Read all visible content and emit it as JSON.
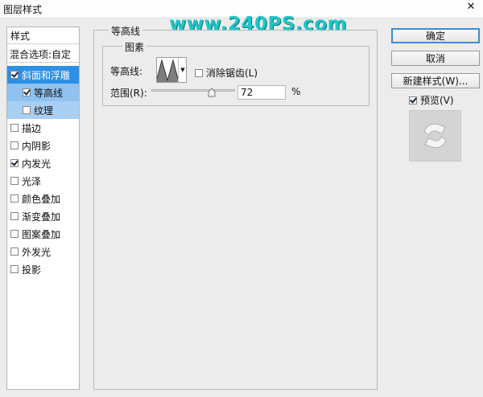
{
  "window": {
    "title": "图层样式",
    "close_glyph": "✕"
  },
  "watermark": "www.240PS.com",
  "left_panel": {
    "header": "样式",
    "blend_options": "混合选项:自定",
    "styles": [
      {
        "label": "斜面和浮雕",
        "checked": true,
        "state": "selected",
        "indent": false
      },
      {
        "label": "等高线",
        "checked": true,
        "state": "sub-selected",
        "indent": true
      },
      {
        "label": "纹理",
        "checked": false,
        "state": "sub",
        "indent": true
      },
      {
        "label": "描边",
        "checked": false,
        "state": "none",
        "indent": false
      },
      {
        "label": "内阴影",
        "checked": false,
        "state": "none",
        "indent": false
      },
      {
        "label": "内发光",
        "checked": true,
        "state": "none",
        "indent": false
      },
      {
        "label": "光泽",
        "checked": false,
        "state": "none",
        "indent": false
      },
      {
        "label": "颜色叠加",
        "checked": false,
        "state": "none",
        "indent": false
      },
      {
        "label": "渐变叠加",
        "checked": false,
        "state": "none",
        "indent": false
      },
      {
        "label": "图案叠加",
        "checked": false,
        "state": "none",
        "indent": false
      },
      {
        "label": "外发光",
        "checked": false,
        "state": "none",
        "indent": false
      },
      {
        "label": "投影",
        "checked": false,
        "state": "none",
        "indent": false
      }
    ]
  },
  "contour_panel": {
    "group_title": "等高线",
    "subgroup_title": "图素",
    "contour_label": "等高线:",
    "antialias_label": "消除锯齿(L)",
    "antialias_checked": false,
    "range_label": "范围(R):",
    "range_value": "72",
    "range_unit": "%",
    "range_fraction": 0.72
  },
  "buttons": {
    "ok": "确定",
    "cancel": "取消",
    "new_style": "新建样式(W)...",
    "preview_label": "预览(V)",
    "preview_checked": true
  }
}
